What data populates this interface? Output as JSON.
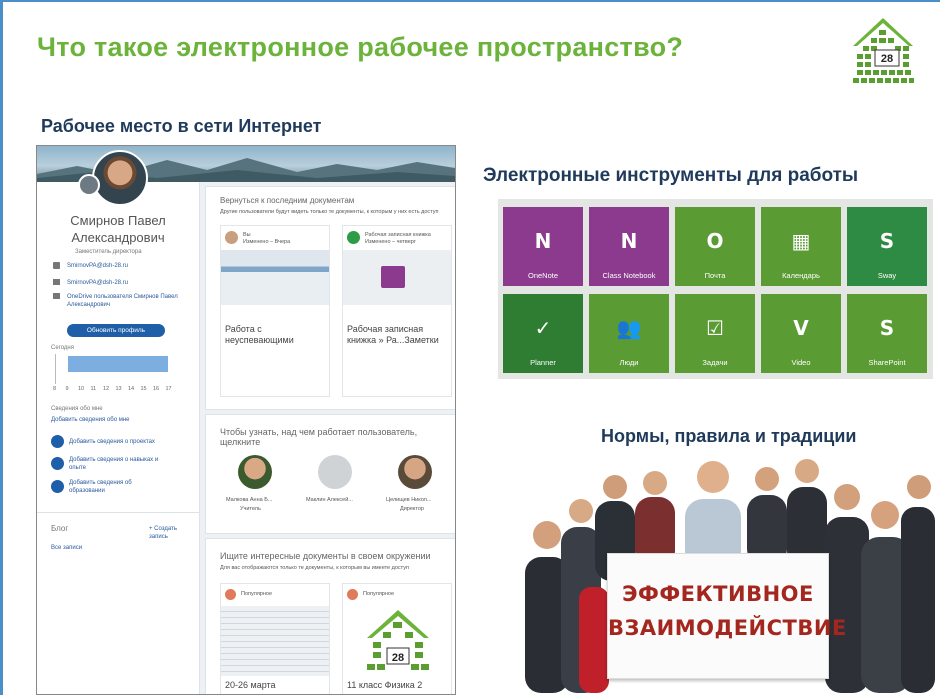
{
  "slide": {
    "title": "Что такое электронное рабочее пространство?",
    "logo_number": "28",
    "section_web": "Рабочее место в сети Интернет",
    "section_tools": "Электронные инструменты для работы",
    "section_norms": "Нормы, правила и традиции"
  },
  "profile": {
    "name_line1": "Смирнов Павел",
    "name_line2": "Александрович",
    "role": "Заместитель директора",
    "email1": "SmirnovPA@dsh-28.ru",
    "email2": "SmirnovPA@dsh-28.ru",
    "onedrive": "OneDrive пользователя Смирнов Павел Александрович",
    "update_button": "Обновить профиль",
    "today_label": "Сегодня",
    "hours": [
      "8",
      "9",
      "10",
      "11",
      "12",
      "13",
      "14",
      "15",
      "16",
      "17"
    ],
    "about_label": "Сведения обо мне",
    "about_link": "Добавить сведения обо мне",
    "add_projects": "Добавить сведения о проектах",
    "add_skills": "Добавить сведения о навыках и опыте",
    "add_education": "Добавить сведения об образовании",
    "blog_label": "Блог",
    "create_post": "+ Создать запись",
    "all_posts": "Все записи",
    "recent_title": "Вернуться к последним документам",
    "recent_subtitle": "Другие пользователи будут видеть только те документы, к которым у них есть доступ",
    "doc1_caption": "Работа с неуспевающими",
    "doc2_caption": "Рабочая записная книжка » Ра...Заметки",
    "doc1_owner": "Вы",
    "doc1_when": "Изменено – Вчера",
    "doc2_owner": "Рабочая записная книжка",
    "doc2_when": "Изменено – четверг",
    "work_title": "Чтобы узнать, над чем работает пользователь, щелкните",
    "person1": "Малкова Анна Б...",
    "person1_role": "Учитель",
    "person2": "Маклин Алексей...",
    "person3": "Целищев Никол...",
    "person3_role": "Директор",
    "find_title": "Ищите интересные документы в своем окружении",
    "find_subtitle": "Для вас отображаются только те документы, к которым вы имеете доступ",
    "doc3_caption": "20-26 марта",
    "doc4_caption": "11 класс Физика 2",
    "popular": "Популярное"
  },
  "tiles": [
    {
      "icon": "N",
      "label": "OneNote",
      "color": "#8b3a8e"
    },
    {
      "icon": "N",
      "label": "Class Notebook",
      "color": "#8b3a8e"
    },
    {
      "icon": "O",
      "label": "Почта",
      "color": "#5b9b34"
    },
    {
      "icon": "▦",
      "label": "Календарь",
      "color": "#5b9b34"
    },
    {
      "icon": "S",
      "label": "Sway",
      "color": "#2e8b44"
    },
    {
      "icon": "✓",
      "label": "Planner",
      "color": "#2e7d32"
    },
    {
      "icon": "👥",
      "label": "Люди",
      "color": "#5b9b34"
    },
    {
      "icon": "☑",
      "label": "Задачи",
      "color": "#5b9b34"
    },
    {
      "icon": "V",
      "label": "Video",
      "color": "#5b9b34"
    },
    {
      "icon": "S",
      "label": "SharePoint",
      "color": "#5b9b34"
    }
  ],
  "sign": {
    "line1": "ЭФФЕКТИВНОЕ",
    "line2": "ВЗАИМОДЕЙСТВИЕ"
  },
  "colors": {
    "title_green": "#6bb33a",
    "heading_navy": "#1f3a5a",
    "frame_blue": "#4a8fc8"
  }
}
